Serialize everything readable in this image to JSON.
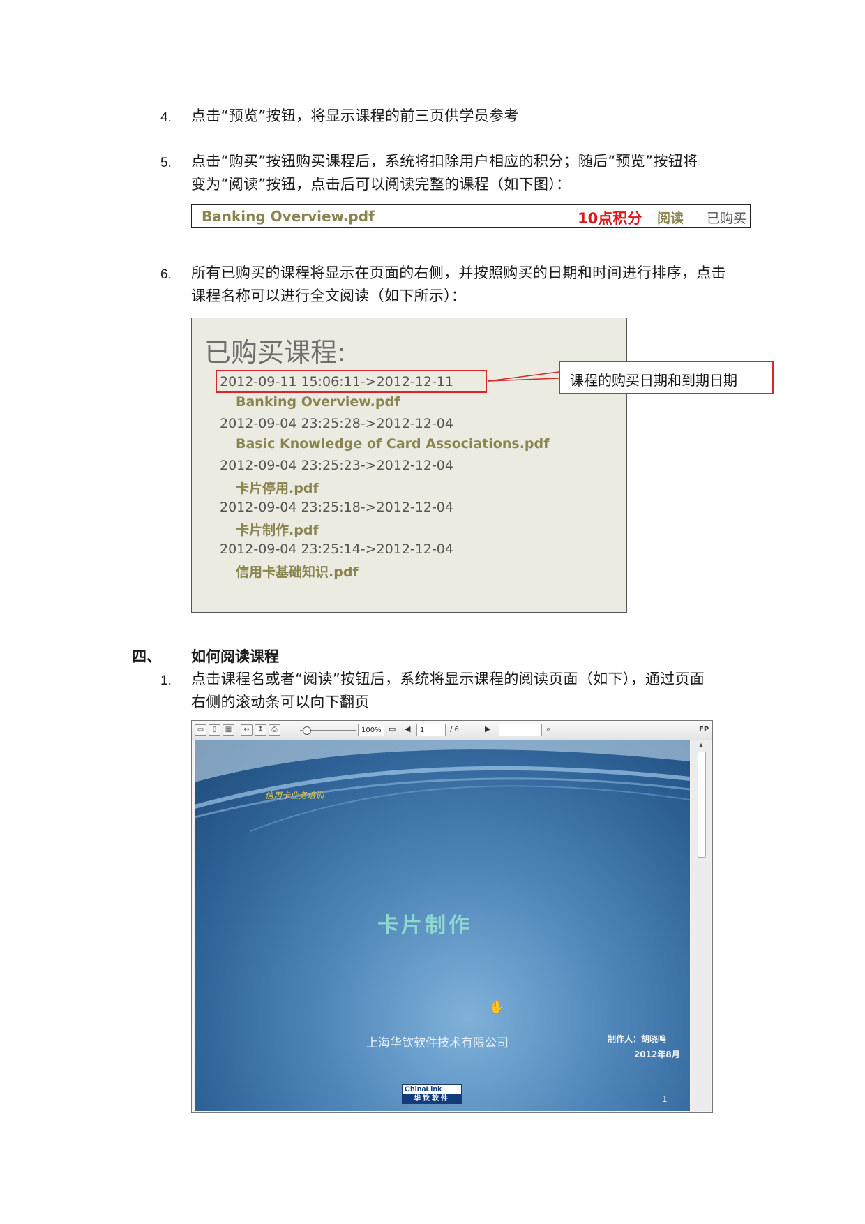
{
  "step4": {
    "num": "4.",
    "text": "点击“预览”按钮，将显示课程的前三页供学员参考"
  },
  "step5": {
    "num": "5.",
    "line1": "点击“购买”按钮购买课程后，系统将扣除用户相应的积分；随后“预览”按钮将",
    "line2": "变为“阅读”按钮，点击后可以阅读完整的课程（如下图）："
  },
  "course_row": {
    "name": "Banking Overview.pdf",
    "points": "10点积分",
    "read": "阅读",
    "purchased": "已购买"
  },
  "step6": {
    "num": "6.",
    "line1": "所有已购买的课程将显示在页面的右侧，并按照购买的日期和时间进行排序，点击",
    "line2": "课程名称可以进行全文阅读（如下所示）："
  },
  "purchased_panel": {
    "title": "已购买课程:",
    "items": [
      {
        "date": "2012-09-11 15:06:11->2012-12-11",
        "file": "Banking Overview.pdf"
      },
      {
        "date": "2012-09-04 23:25:28->2012-12-04",
        "file": "Basic Knowledge of Card Associations.pdf"
      },
      {
        "date": "2012-09-04 23:25:23->2012-12-04",
        "file": "卡片停用.pdf"
      },
      {
        "date": "2012-09-04 23:25:18->2012-12-04",
        "file": "卡片制作.pdf"
      },
      {
        "date": "2012-09-04 23:25:14->2012-12-04",
        "file": "信用卡基础知识.pdf"
      }
    ],
    "callout": "课程的购买日期和到期日期"
  },
  "section4": {
    "num": "四、",
    "title": "如何阅读课程"
  },
  "step1": {
    "num": "1.",
    "line1": "点击课程名或者“阅读”按钮后，系统将显示课程的阅读页面（如下），通过页面",
    "line2": "右侧的滚动条可以向下翻页"
  },
  "viewer": {
    "zoom": "100%",
    "page_input": "1",
    "page_total": "/ 6",
    "fp": "FP",
    "slide": {
      "subtitle": "信用卡业务培训",
      "title": "卡片制作",
      "company": "上海华钦软件技术有限公司",
      "author": "制作人：胡晓鸣",
      "date": "2012年8月",
      "page_number": "1",
      "logo_top": "ChinaLink",
      "logo_bottom": "华钦软件"
    }
  },
  "colors": {
    "course_name": "#8a8451",
    "points": "#e0161b",
    "callout_border": "#d9262a",
    "panel_bg": "#ecebe2"
  },
  "icons": [
    "single-page-icon",
    "two-page-icon",
    "grid-view-icon",
    "fit-width-icon",
    "fit-height-icon",
    "print-icon",
    "fullscreen-icon",
    "prev-page-icon",
    "next-page-icon",
    "search-icon",
    "hand-cursor-icon"
  ]
}
